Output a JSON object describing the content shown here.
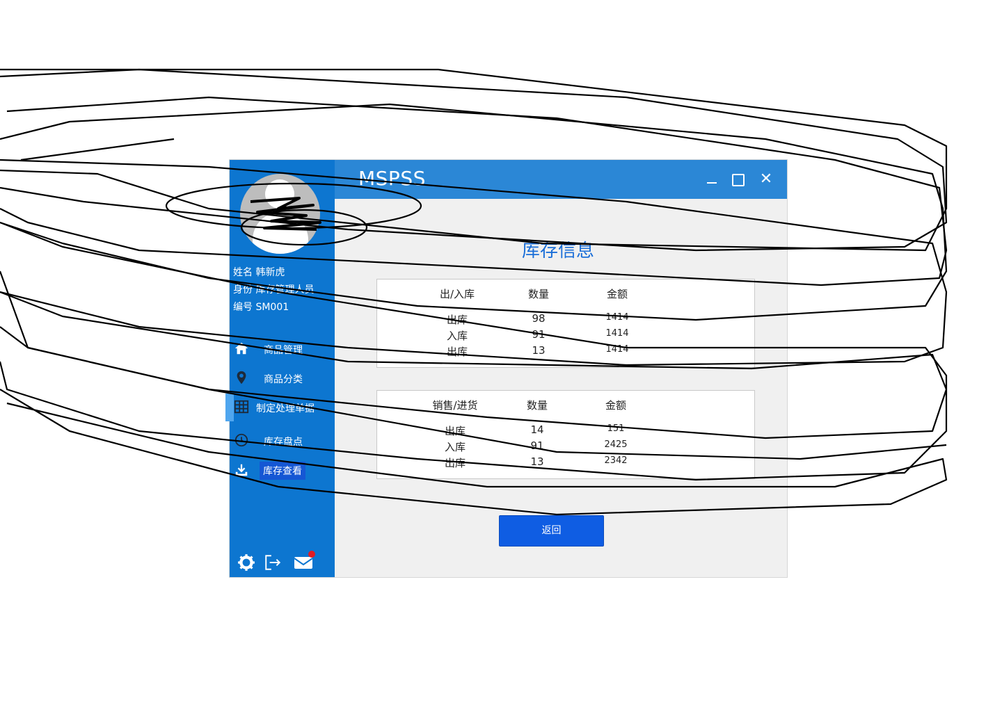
{
  "window": {
    "app_title": "MSPSS",
    "controls": {
      "minimize": "minimize-icon",
      "maximize": "maximize-icon",
      "close": "close-icon"
    },
    "close_glyph": "✕"
  },
  "sidebar": {
    "name_line": "姓名 韩新虎",
    "role_line": "身份 库存管理人员",
    "id_line": "编号 SM001",
    "items": [
      {
        "label": "商品管理",
        "icon": "home-icon"
      },
      {
        "label": "商品分类",
        "icon": "map-pin-icon"
      },
      {
        "label": "制定处理单据",
        "icon": "grid-table-icon"
      },
      {
        "label": "库存盘点",
        "icon": "clock-icon"
      },
      {
        "label": "库存查看",
        "icon": "download-icon",
        "active": true
      }
    ],
    "bottom_icons": [
      "gear-icon",
      "logout-icon",
      "mail-icon"
    ]
  },
  "main": {
    "title": "库存信息",
    "io_table": {
      "headers": [
        "出/入库",
        "数量",
        "金额"
      ],
      "rows": [
        [
          "出库",
          "98",
          "1414"
        ],
        [
          "入库",
          "91",
          "1414"
        ],
        [
          "出库",
          "13",
          "1414"
        ]
      ]
    },
    "sales_table": {
      "headers": [
        "销售/进货",
        "数量",
        "金额"
      ],
      "rows": [
        [
          "出库",
          "14",
          "151"
        ],
        [
          "入库",
          "91",
          "2425"
        ],
        [
          "出库",
          "13",
          "2342"
        ]
      ]
    },
    "back_button": "返回"
  },
  "colors": {
    "sidebar": "#0d76d0",
    "titlebar": "#2b87d6",
    "accent": "#1a6ed8",
    "button": "#0f5de3",
    "notification": "#e31b23"
  }
}
